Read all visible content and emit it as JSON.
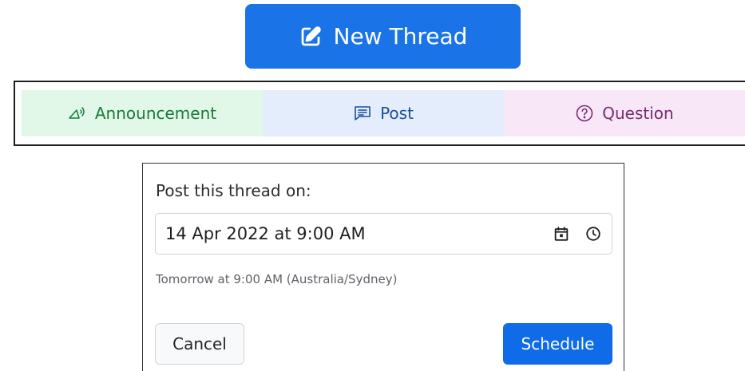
{
  "new_thread": {
    "label": "New Thread",
    "icon": "edit-icon",
    "color": "#1a74e8"
  },
  "thread_types": [
    {
      "label": "Announcement",
      "icon": "megaphone-icon",
      "bg": "#e1f7e7",
      "fg": "#1a7a3c"
    },
    {
      "label": "Post",
      "icon": "post-icon",
      "bg": "#e3edfc",
      "fg": "#1a4fa0"
    },
    {
      "label": "Question",
      "icon": "question-icon",
      "bg": "#f8e7f7",
      "fg": "#7a2a72"
    }
  ],
  "schedule": {
    "label": "Post this thread on:",
    "datetime_value": "14 Apr 2022 at 9:00 AM",
    "hint": "Tomorrow at 9:00 AM (Australia/Sydney)",
    "cancel_label": "Cancel",
    "schedule_label": "Schedule",
    "schedule_color": "#0f6be8",
    "icons": [
      "calendar-icon",
      "clock-icon"
    ]
  }
}
